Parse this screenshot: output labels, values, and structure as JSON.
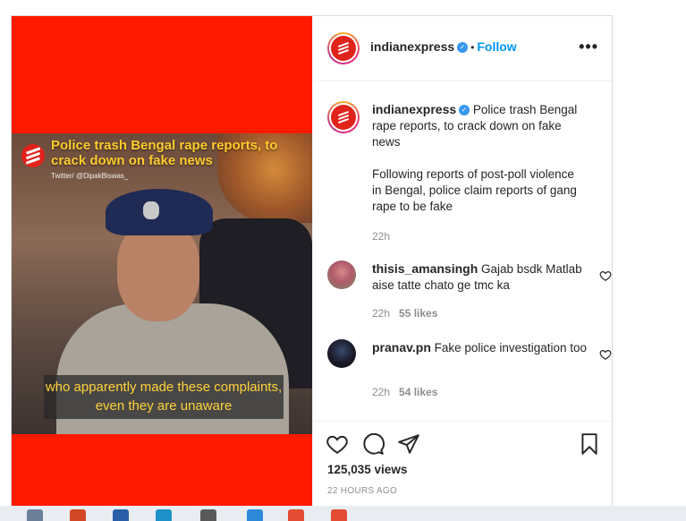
{
  "account": {
    "username": "indianexpress",
    "follow_label": "Follow",
    "separator": "•"
  },
  "video": {
    "headline": "Police trash Bengal rape reports, to crack down on fake news",
    "credit": "Twitter/ @DipakBiswas_",
    "subtitle": "who apparently made these complaints, even they are unaware"
  },
  "caption": {
    "username": "indianexpress",
    "text_line": "Police trash Bengal rape reports, to crack down on fake news",
    "paragraph": "Following reports of post-poll violence in Bengal, police claim reports of gang rape to be fake",
    "time": "22h"
  },
  "comments": [
    {
      "username": "thisis_amansingh",
      "text": "Gajab bsdk Matlab aise tatte chato ge tmc ka",
      "time": "22h",
      "likes": "55 likes"
    },
    {
      "username": "pranav.pn",
      "text": "Fake police investigation too",
      "time": "22h",
      "likes": "54 likes"
    }
  ],
  "stats": {
    "views": "125,035 views",
    "posted": "22 HOURS AGO"
  },
  "colors": {
    "brand_red": "#e0231b",
    "follow_blue": "#0095f6",
    "headline_yellow": "#ffcc2e"
  },
  "icons": {
    "like": "heart-icon",
    "comment": "comment-icon",
    "share": "share-icon",
    "save": "bookmark-icon",
    "more": "more-icon"
  }
}
